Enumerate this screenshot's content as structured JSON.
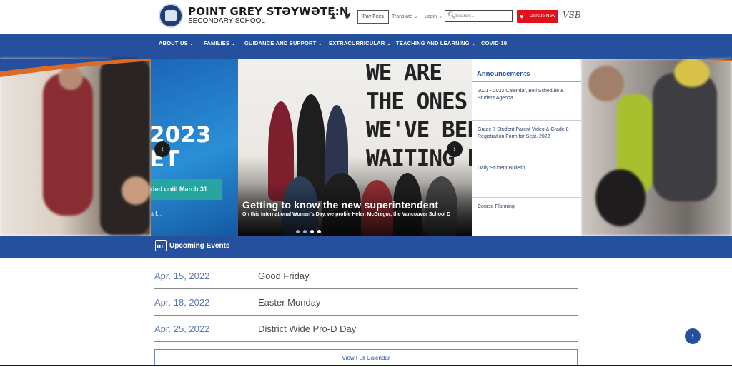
{
  "header": {
    "school_name": "POINT GREY STƏYWƏTE:N",
    "school_sub": "SECONDARY SCHOOL",
    "pay_fees": "Pay Fees",
    "translate": "Translate ⌄",
    "login": "Login ⌄",
    "search_placeholder": "Search...",
    "donate": "Donate Now",
    "vsb_logo": "VSB"
  },
  "nav": {
    "items": [
      "ABOUT US ⌄",
      "FAMILIES ⌄",
      "GUIDANCE AND SUPPORT ⌄",
      "EXTRACURRICULAR ⌄",
      "TEACHING AND LEARNING ⌄",
      "COVID-19"
    ]
  },
  "slider": {
    "prev_big_line1": "2023",
    "prev_big_line2": "ET",
    "prev_tag": "ded until March 31",
    "prev_frag": "s f...",
    "mural": "WE ARE\nTHE ONES\nWE'VE BEEN\nWAITING FOR",
    "title": "Getting to know the new superintendent",
    "description": "On this International Women's Day, we profile Helen McGregor, the Vancouver School D",
    "prev_arrow": "‹",
    "next_arrow": "›",
    "active_dot": 2
  },
  "announcements": {
    "title": "Announcements",
    "items": [
      "2021 - 2022 Calendar, Bell Schedule & Student Agenda",
      "Grade 7 Student Parent Video & Grade 8 Registration Form for Sept. 2022",
      "Daily Student Bulletin",
      "Course Planning"
    ]
  },
  "events": {
    "title": "Upcoming Events",
    "rows": [
      {
        "date": "Apr. 15, 2022",
        "name": "Good Friday"
      },
      {
        "date": "Apr. 18, 2022",
        "name": "Easter Monday"
      },
      {
        "date": "Apr. 25, 2022",
        "name": "District Wide Pro-D Day"
      }
    ],
    "view_full": "View Full Calendar"
  },
  "colors": {
    "primary_blue": "#25509e",
    "accent_orange": "#e06a25",
    "donate_red": "#e3101b"
  }
}
